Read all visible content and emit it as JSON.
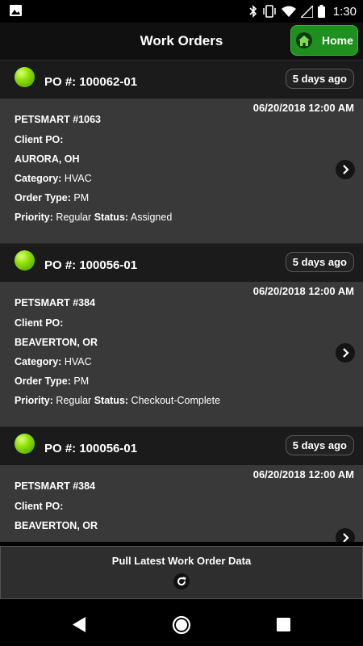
{
  "status_bar": {
    "time": "1:30"
  },
  "app_bar": {
    "title": "Work Orders",
    "home_label": "Home"
  },
  "work_orders": [
    {
      "po": "PO #: 100062-01",
      "age": "5 days ago",
      "date": "06/20/2018 12:00 AM",
      "store": "PETSMART #1063",
      "client_po_label": "Client PO:",
      "location": "AURORA, OH",
      "category_label": "Category:",
      "category": "HVAC",
      "order_type_label": "Order Type:",
      "order_type": "PM",
      "priority_label": "Priority:",
      "priority": "Regular",
      "status_label": "Status:",
      "status": "Assigned"
    },
    {
      "po": "PO #: 100056-01",
      "age": "5 days ago",
      "date": "06/20/2018 12:00 AM",
      "store": "PETSMART #384",
      "client_po_label": "Client PO:",
      "location": "BEAVERTON, OR",
      "category_label": "Category:",
      "category": "HVAC",
      "order_type_label": "Order Type:",
      "order_type": "PM",
      "priority_label": "Priority:",
      "priority": "Regular",
      "status_label": "Status:",
      "status": "Checkout-Complete"
    },
    {
      "po": "PO #: 100056-01",
      "age": "5 days ago",
      "date": "06/20/2018 12:00 AM",
      "store": "PETSMART #384",
      "client_po_label": "Client PO:",
      "location": "BEAVERTON, OR"
    }
  ],
  "pull_button": {
    "label": "Pull Latest Work Order Data"
  },
  "colors": {
    "home_green": "#1f8f1f",
    "status_dot": "#8ce000",
    "card_bg": "#393939",
    "header_bg": "#1b1b1b"
  },
  "icons": [
    "image-icon",
    "bluetooth-icon",
    "vibrate-icon",
    "wifi-icon",
    "signal-icon",
    "battery-icon",
    "home-icon",
    "chevron-right-icon",
    "refresh-icon",
    "back-icon",
    "home-nav-icon",
    "recents-icon"
  ]
}
